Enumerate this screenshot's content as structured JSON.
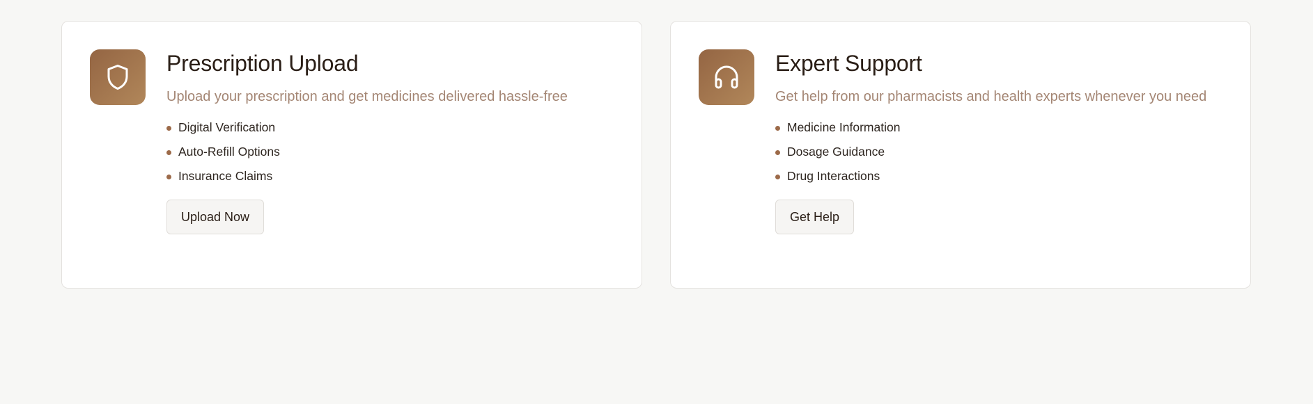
{
  "colors": {
    "page_background": "#f7f7f5",
    "card_background": "#ffffff",
    "accent": "#9c6a49",
    "title_text": "#2a1e16",
    "description_text": "#a48674"
  },
  "cards": [
    {
      "icon": "shield-icon",
      "title": "Prescription Upload",
      "description": "Upload your prescription and get medicines delivered hassle-free",
      "features": [
        "Digital Verification",
        "Auto-Refill Options",
        "Insurance Claims"
      ],
      "button_label": "Upload Now"
    },
    {
      "icon": "headphones-icon",
      "title": "Expert Support",
      "description": "Get help from our pharmacists and health experts whenever you need",
      "features": [
        "Medicine Information",
        "Dosage Guidance",
        "Drug Interactions"
      ],
      "button_label": "Get Help"
    }
  ]
}
